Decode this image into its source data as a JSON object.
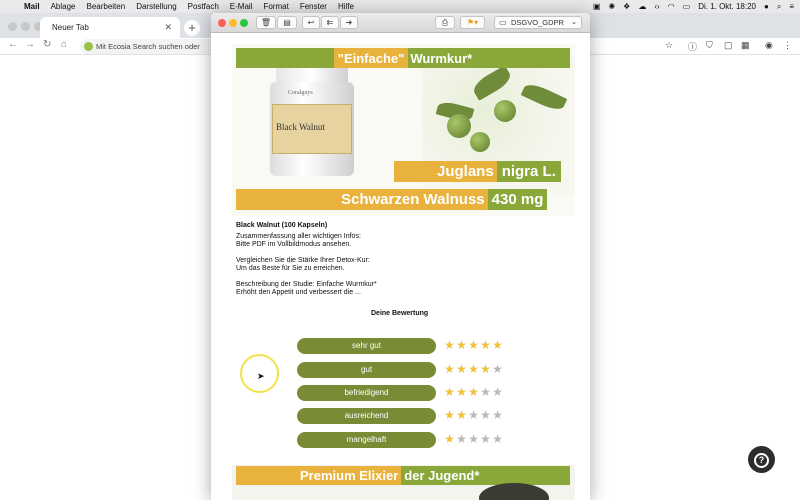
{
  "menubar": {
    "app": "Mail",
    "items": [
      "Ablage",
      "Bearbeiten",
      "Darstellung",
      "Postfach",
      "E-Mail",
      "Format",
      "Fenster",
      "Hilfe"
    ],
    "clock": "Di. 1. Okt.  18:20"
  },
  "browser": {
    "tab_title": "Neuer Tab",
    "omnibox_placeholder": "Mit Ecosia Search suchen oder"
  },
  "mail": {
    "mailbox": "DSGVO_GDPR",
    "banner": {
      "title_a": "\"Einfache\"",
      "title_b": "Wurmkur*",
      "latin_a": "Juglans",
      "latin_b": "nigra L.",
      "name_a": "Schwarzen Walnuss",
      "name_b": "430 mg",
      "bottle_label": "Black Walnut",
      "bottle_brand": "Coralguys"
    },
    "body": {
      "product": "Black Walnut (100 Kapseln)",
      "p1_l1": "Zusammenfassung aller wichtigen Infos:",
      "p1_l2": "Bitte PDF im Vollbildmodus ansehen.",
      "p2_l1": "Vergleichen Sie die Stärke Ihrer Detox-Kur:",
      "p2_l2": "Um das Beste für Sie zu erreichen.",
      "p3_l1": "Beschreibung der Studie: Einfache Wurmkur*",
      "p3_l2": "Erhöht den Appetit und verbessert die ..."
    },
    "rating": {
      "title": "Deine Bewertung",
      "options": [
        {
          "label": "sehr gut",
          "stars": 5
        },
        {
          "label": "gut",
          "stars": 4
        },
        {
          "label": "befriedigend",
          "stars": 3
        },
        {
          "label": "ausreichend",
          "stars": 2
        },
        {
          "label": "mangelhaft",
          "stars": 1
        }
      ]
    },
    "banner2": {
      "title_a": "Premium Elixier",
      "title_b": "der Jugend*"
    }
  },
  "colors": {
    "green": "#8aa83a",
    "orange": "#e8b23c",
    "button_green": "#7a8b35",
    "star_on": "#f0c23a",
    "star_off": "#b9b9b9"
  }
}
